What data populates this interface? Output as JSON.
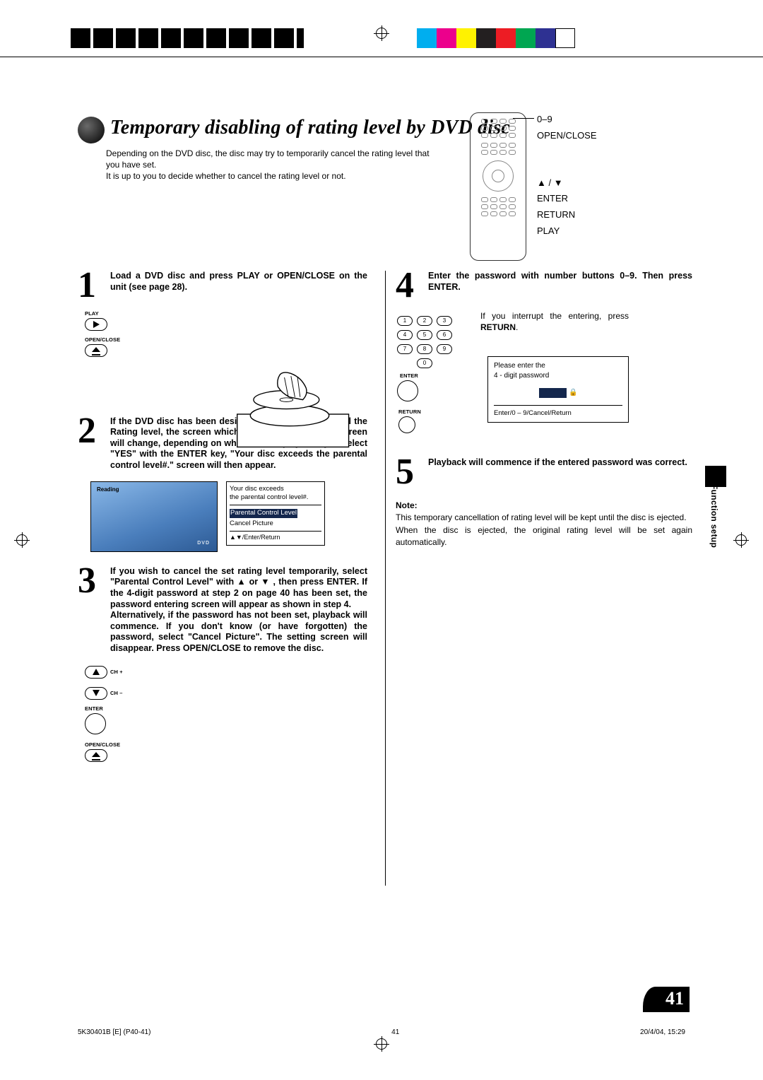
{
  "header": {
    "title": "Temporary disabling of rating level by DVD disc",
    "intro_line1": "Depending on the DVD disc, the disc may try to temporarily cancel the rating level that you have set.",
    "intro_line2": "It is up to you to decide whether to cancel the rating level or not."
  },
  "remote_labels": {
    "l1": "0–9",
    "l2": "OPEN/CLOSE",
    "l3": "▲ / ▼",
    "l4": "ENTER",
    "l5": "RETURN",
    "l6": "PLAY"
  },
  "steps": {
    "s1": {
      "num": "1",
      "text": "Load a DVD disc and press PLAY or OPEN/CLOSE on the unit (see page 28).",
      "btn_play_label": "PLAY",
      "btn_open_label": "OPEN/CLOSE"
    },
    "s2": {
      "num": "2",
      "text": "If the DVD disc has been designed to temporarily cancel the Rating level, the screen which follows the \"Reading\" screen will change, depending on which disc is played. If you select \"YES\" with the ENTER key, \"Your disc exceeds the parental control level#.\" screen will then appear.",
      "screen_label": "Reading",
      "dlg_line1": "Your disc exceeds",
      "dlg_line2": "the parental control level#.",
      "dlg_opt1": "Parental Control Level",
      "dlg_opt2": "Cancel Picture",
      "dlg_foot": "▲▼/Enter/Return"
    },
    "s3": {
      "num": "3",
      "text": "If you wish to cancel the set rating level temporarily, select \"Parental Control Level\" with ▲ or ▼ , then press ENTER. If the 4-digit password at step 2 on page 40 has been set, the password entering screen will appear as shown in step 4.\nAlternatively, if the password has not been set, playback will commence. If you don't know (or have forgotten) the password, select \"Cancel Picture\". The setting screen will disappear. Press OPEN/CLOSE to remove the disc.",
      "btn_chplus": "CH +",
      "btn_chminus": "CH –",
      "btn_enter": "ENTER",
      "btn_open": "OPEN/CLOSE"
    },
    "s4": {
      "num": "4",
      "text": "Enter the password with number buttons 0–9. Then press ENTER.",
      "interrupt1": "If you interrupt the entering, press ",
      "interrupt2": "RETURN",
      "interrupt3": ".",
      "keypad": [
        "1",
        "2",
        "3",
        "4",
        "5",
        "6",
        "7",
        "8",
        "9",
        "0"
      ],
      "btn_enter": "ENTER",
      "btn_return": "RETURN",
      "pw_line1": "Please enter the",
      "pw_line2": "4 - digit password",
      "pw_foot": "Enter/0 – 9/Cancel/Return"
    },
    "s5": {
      "num": "5",
      "text": "Playback will commence if the entered password was correct."
    }
  },
  "note": {
    "heading": "Note:",
    "line1": "This temporary cancellation of rating level will be kept until the disc is ejected.",
    "line2": "When the disc is ejected, the original rating level will be set again automatically."
  },
  "sidetab": "Function setup",
  "page_number": "41",
  "footer": {
    "left": "5K30401B [E] (P40-41)",
    "mid": "41",
    "right": "20/4/04, 15:29"
  },
  "colorbar": [
    "#00aeef",
    "#ec008c",
    "#fff200",
    "#231f20",
    "#ed1c24",
    "#00a651",
    "#2e3192",
    "#ffffff"
  ]
}
